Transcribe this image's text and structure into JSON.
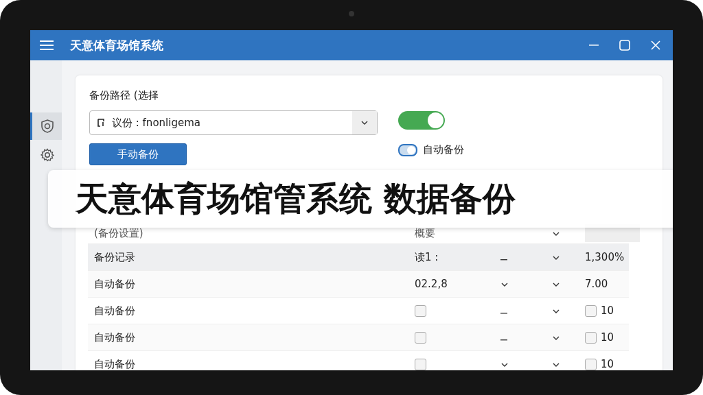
{
  "window": {
    "title": "天意体育场馆系统"
  },
  "sidebar": {
    "items": [
      {
        "kind": "shield",
        "selected": true
      },
      {
        "kind": "gear",
        "selected": false
      }
    ]
  },
  "backup_path": {
    "label": "备份路径 (选择",
    "value": "议份 : fnonligema"
  },
  "main_toggle": {
    "on": true
  },
  "manual_backup_button": "手动备份",
  "auto_backup_toggle": {
    "label": "自动备份",
    "on": true
  },
  "banner": {
    "text": "天意体育场馆管系统 数据备份"
  },
  "table": {
    "header": {
      "label": "(备份设置)",
      "column_2": "概要"
    },
    "rows": [
      {
        "name": "备份记录",
        "selected": true,
        "column_2": {
          "text": "读1 :"
        },
        "column_3": {
          "kind": "dash"
        },
        "column_4": {
          "kind": "chevron"
        },
        "column_5": {
          "text": "1,300%"
        }
      },
      {
        "name": "自动备份",
        "selected": false,
        "column_2": {
          "text": "02.2,8"
        },
        "column_3": {
          "kind": "chevron"
        },
        "column_4": {
          "kind": "chevron"
        },
        "column_5": {
          "text": "7.00"
        }
      },
      {
        "name": "自动备份",
        "selected": false,
        "column_2": {
          "checked": false
        },
        "column_3": {
          "kind": "dash"
        },
        "column_4": {
          "kind": "chevron"
        },
        "column_5": {
          "checked": false,
          "text": "10"
        }
      },
      {
        "name": "自动备份",
        "selected": false,
        "column_2": {
          "checked": false
        },
        "column_3": {
          "kind": "dash"
        },
        "column_4": {
          "kind": "chevron"
        },
        "column_5": {
          "checked": false,
          "text": "10"
        }
      },
      {
        "name": "自动备份",
        "selected": false,
        "column_2": {
          "checked": false
        },
        "column_3": {
          "kind": "chevron"
        },
        "column_4": {
          "kind": "chevron"
        },
        "column_5": {
          "checked": false,
          "text": "10"
        }
      }
    ]
  }
}
